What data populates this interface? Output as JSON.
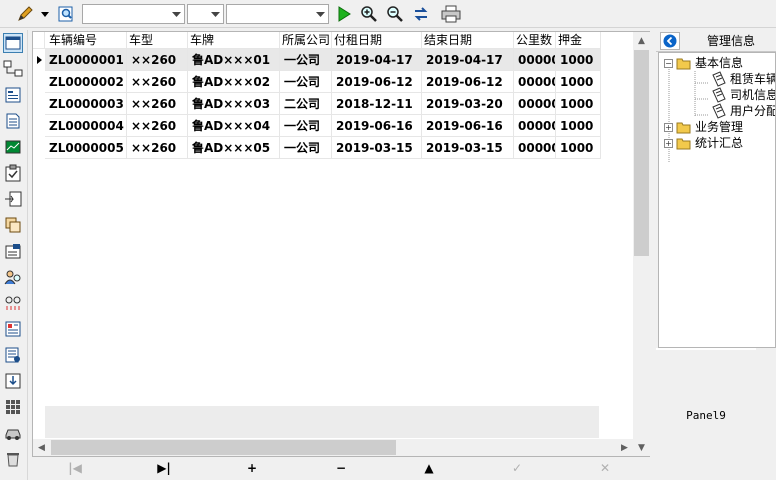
{
  "toolbar": {
    "combo1_value": "",
    "combo2_value": "",
    "combo3_value": ""
  },
  "grid": {
    "columns": [
      "车辆编号",
      "车型",
      "车牌",
      "所属公司",
      "付租日期",
      "结束日期",
      "公里数",
      "押金"
    ],
    "rows": [
      [
        "ZL0000001",
        "××260",
        "鲁AD×××01",
        "一公司",
        "2019-04-17",
        "2019-04-17",
        "00000",
        "1000"
      ],
      [
        "ZL0000002",
        "××260",
        "鲁AD×××02",
        "一公司",
        "2019-06-12",
        "2019-06-12",
        "00000",
        "1000"
      ],
      [
        "ZL0000003",
        "××260",
        "鲁AD×××03",
        "二公司",
        "2018-12-11",
        "2019-03-20",
        "00000",
        "1000"
      ],
      [
        "ZL0000004",
        "××260",
        "鲁AD×××04",
        "一公司",
        "2019-06-16",
        "2019-06-16",
        "00000",
        "1000"
      ],
      [
        "ZL0000005",
        "××260",
        "鲁AD×××05",
        "一公司",
        "2019-03-15",
        "2019-03-15",
        "00000",
        "1000"
      ]
    ],
    "selected_row": 0
  },
  "navigator": {
    "first": "|◀",
    "last": "▶|",
    "insert": "+",
    "delete": "−",
    "edit": "▲",
    "post": "✓",
    "cancel": "✕"
  },
  "right_panel": {
    "title": "管理信息",
    "tree": {
      "basic_info": "基本信息",
      "children": [
        "租赁车辆",
        "司机信息",
        "用户分配"
      ],
      "business": "业务管理",
      "stats": "统计汇总"
    },
    "panel_label": "Panel9"
  },
  "colors": {
    "accent": "#0a64c8",
    "selected_row": "#e8e8e8",
    "folder": "#f2c94c"
  }
}
